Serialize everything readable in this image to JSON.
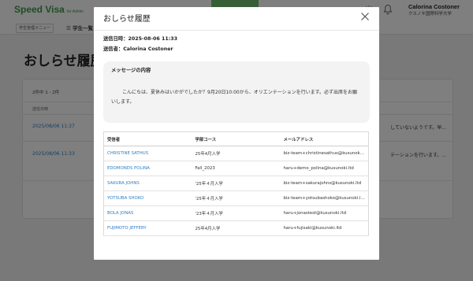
{
  "app": {
    "brand": "Speed Visa",
    "brand_sub": "for Admin"
  },
  "header": {
    "user_name": "Calorina Costoner",
    "school": "クスノキ国際科学大学"
  },
  "subnav": {
    "menu_button": "学生管理メニュー",
    "list_label": "学生一覧"
  },
  "page": {
    "title": "おしらせ履歴"
  },
  "card": {
    "count": "2件中 1 - 2件",
    "column_header": "送信日時",
    "rows": [
      {
        "date": "2025/08/06 11:37",
        "tail": "していないようです。早..."
      },
      {
        "date": "2025/08/06 11:33",
        "tail": "テーションを行います。..."
      }
    ]
  },
  "modal": {
    "title": "おしらせ履歴",
    "sent_label": "送信日時：",
    "sent_value": "2025-08-06 11:33",
    "sender_label": "送信者：",
    "sender_value": "Calorina Costoner",
    "message_heading": "メッセージの内容",
    "message_body": "こんにちは、夏休みはいかがでしたか？9月20日10:00から、オリエンテーションを行います。必ず出席をお願いします。",
    "table": {
      "headers": [
        "受信者",
        "学部コース",
        "メールアドレス"
      ],
      "rows": [
        {
          "name": "CHRISTINE SATHUS",
          "course": "25年4月入学",
          "email": "biz-team+christinesathus@kusunoki.ltd"
        },
        {
          "name": "EDOMONDS POLINA",
          "course": "Fall_2023",
          "email": "haru+demo_polina@kusunoki.ltd"
        },
        {
          "name": "SAKURA JOHNS",
          "course": "'25年４月入学",
          "email": "biz-team+sakurajohns@kusunoki.ltd"
        },
        {
          "name": "YOTSUBA SHOKO",
          "course": "'25年４月入学",
          "email": "biz-team+yotsubashoko@kusunoki.ltd"
        },
        {
          "name": "BOLA JONAS",
          "course": "'23年４月入学",
          "email": "haru+jonastest@kusunoki.ltd"
        },
        {
          "name": "FUJIMOTO JEFFERY",
          "course": "25年4月入学",
          "email": "haru+fujisaki@kusunoki.ltd"
        }
      ]
    }
  },
  "icons": {
    "settings": "gear-icon",
    "notifications": "bell-icon",
    "close": "close-icon",
    "list": "list-icon"
  },
  "colors": {
    "brand": "#3d9a4a",
    "link": "#2f7fc6",
    "overlay": "rgba(0,0,0,0.5)"
  }
}
